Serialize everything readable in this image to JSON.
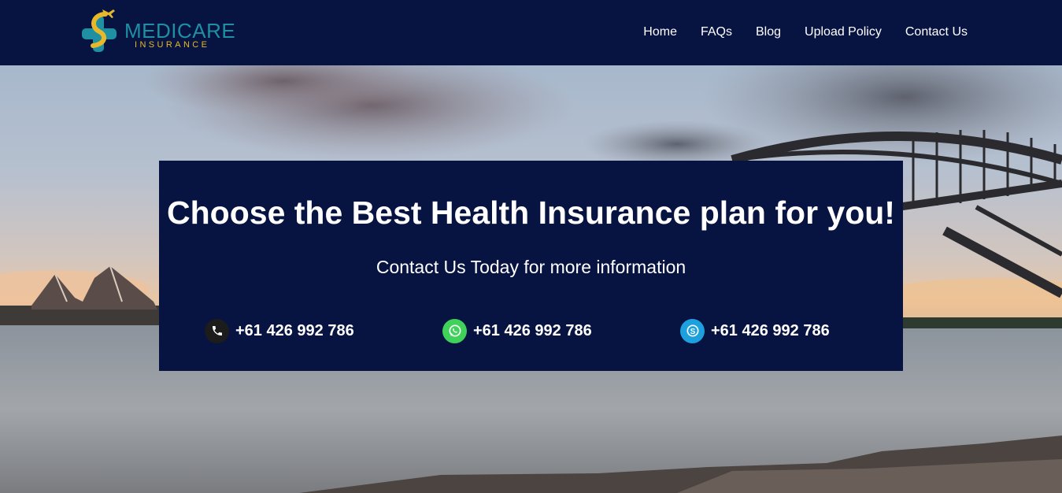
{
  "brand": {
    "name": "MEDICARE",
    "tagline": "INSURANCE"
  },
  "nav": {
    "items": [
      {
        "label": "Home"
      },
      {
        "label": "FAQs"
      },
      {
        "label": "Blog"
      },
      {
        "label": "Upload Policy"
      },
      {
        "label": "Contact Us"
      }
    ]
  },
  "hero": {
    "title": "Choose the Best Health Insurance plan for you!",
    "subtitle": "Contact Us Today for more information",
    "contacts": [
      {
        "icon": "phone-icon",
        "number": "+61 426 992 786"
      },
      {
        "icon": "whatsapp-icon",
        "number": "+61 426 992 786"
      },
      {
        "icon": "skype-icon",
        "number": "+61 426 992 786"
      }
    ]
  },
  "colors": {
    "header_bg": "#071341",
    "card_bg": "#071341",
    "brand_teal": "#1f8fa3",
    "brand_gold": "#e7b92a",
    "whatsapp_green": "#3fd15a",
    "skype_blue": "#1da1de"
  }
}
